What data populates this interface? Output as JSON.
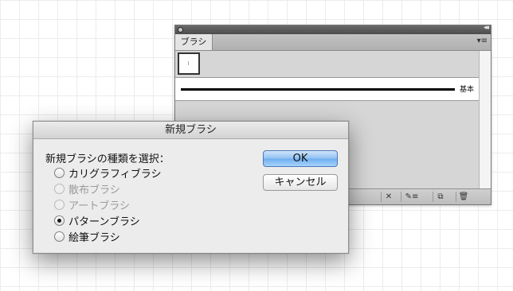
{
  "brushes_panel": {
    "tab_label": "ブラシ",
    "basic_brush_label": "基本",
    "icons": {
      "close": "close-icon",
      "collapse": "collapse-icon",
      "menu": "panel-menu-icon",
      "remove_stroke": "remove-brush-stroke-icon",
      "options": "brush-options-icon",
      "new": "new-brush-icon",
      "delete": "delete-brush-icon"
    },
    "glyphs": {
      "collapse": "◂◂",
      "menu": "▾≡",
      "remove_stroke": "✕",
      "options": "✎≡",
      "new": "⧉",
      "delete": "🗑"
    }
  },
  "new_brush_dialog": {
    "title": "新規ブラシ",
    "prompt": "新規ブラシの種類を選択：",
    "options": [
      {
        "label": "カリグラフィブラシ",
        "enabled": true,
        "checked": false
      },
      {
        "label": "散布ブラシ",
        "enabled": false,
        "checked": false
      },
      {
        "label": "アートブラシ",
        "enabled": false,
        "checked": false
      },
      {
        "label": "パターンブラシ",
        "enabled": true,
        "checked": true
      },
      {
        "label": "絵筆ブラシ",
        "enabled": true,
        "checked": false
      }
    ],
    "ok_label": "OK",
    "cancel_label": "キャンセル",
    "ok_color": "#8fc0f3"
  }
}
